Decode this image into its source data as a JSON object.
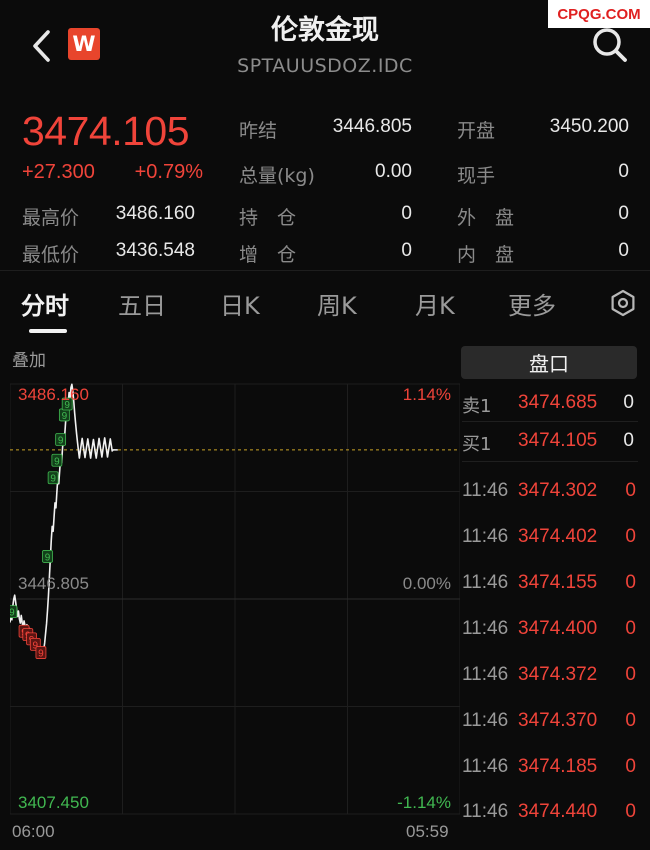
{
  "header": {
    "title": "伦敦金现",
    "subtitle": "SPTAUUSDOZ.IDC",
    "logo_letter": "W",
    "watermark": "CPQG.COM",
    "back_icon": "chevron-left-icon",
    "search_icon": "search-icon"
  },
  "quote": {
    "price": "3474.105",
    "change": "+27.300",
    "change_pct": "+0.79%",
    "fields": {
      "prev_close": {
        "label": "昨结",
        "value": "3446.805"
      },
      "open": {
        "label": "开盘",
        "value": "3450.200"
      },
      "volume": {
        "label": "总量(kg)",
        "value": "0.00"
      },
      "current_hand": {
        "label": "现手",
        "value": "0"
      },
      "high": {
        "label": "最高价",
        "value": "3486.160"
      },
      "position": {
        "label": "持　仓",
        "value": "0"
      },
      "outer": {
        "label": "外　盘",
        "value": "0"
      },
      "low": {
        "label": "最低价",
        "value": "3436.548"
      },
      "increase": {
        "label": "增　仓",
        "value": "0"
      },
      "inner": {
        "label": "内　盘",
        "value": "0"
      }
    }
  },
  "tabs": [
    {
      "label": "分时",
      "active": true
    },
    {
      "label": "五日",
      "active": false
    },
    {
      "label": "日K",
      "active": false
    },
    {
      "label": "周K",
      "active": false
    },
    {
      "label": "月K",
      "active": false
    },
    {
      "label": "更多",
      "active": false
    }
  ],
  "overlay_label": "叠加",
  "chart_data": {
    "type": "line",
    "y_labels": {
      "top": "3486.160",
      "mid": "3446.805",
      "bottom": "3407.450"
    },
    "pct_labels": {
      "top": "1.14%",
      "mid": "0.00%",
      "bottom": "-1.14%"
    },
    "x_labels": {
      "start": "06:00",
      "end": "05:59"
    },
    "ylim": [
      3407.45,
      3486.16
    ],
    "prev_close": 3446.805,
    "current": 3474.105,
    "session_minutes": 1440,
    "x": [
      0,
      3,
      6,
      9,
      12,
      15,
      18,
      21,
      24,
      27,
      30,
      33,
      36,
      39,
      42,
      45,
      48,
      51,
      54,
      57,
      60,
      63,
      66,
      69,
      72,
      75,
      78,
      81,
      84,
      87,
      90,
      93,
      96,
      99,
      102,
      105,
      108,
      111,
      114,
      117,
      120,
      123,
      126,
      129,
      132,
      135,
      138,
      141,
      144,
      147,
      150,
      153,
      156,
      159,
      162,
      165,
      168,
      171,
      174,
      177,
      180,
      183,
      186,
      189,
      192,
      195,
      198,
      201,
      204,
      207,
      210,
      213,
      216,
      219,
      222,
      225,
      228,
      231,
      234,
      237,
      240,
      243,
      246,
      249,
      252,
      255,
      258,
      261,
      264,
      267,
      270,
      273,
      276,
      279,
      282,
      285,
      288,
      291,
      294,
      297,
      300,
      303,
      306,
      309,
      312,
      315,
      318,
      321,
      324,
      327,
      330,
      333,
      336,
      339,
      342,
      345
    ],
    "values": [
      3442.5,
      3444.0,
      3443.0,
      3445.5,
      3446.8,
      3447.5,
      3446.3,
      3445.0,
      3443.6,
      3444.6,
      3443.2,
      3442.4,
      3443.8,
      3442.5,
      3441.5,
      3442.8,
      3441.9,
      3440.8,
      3442.1,
      3441.7,
      3440.1,
      3441.4,
      3440.3,
      3439.1,
      3440.4,
      3439.6,
      3438.6,
      3439.9,
      3438.5,
      3437.4,
      3438.6,
      3437.5,
      3436.7,
      3437.9,
      3437.0,
      3436.6,
      3437.5,
      3438.8,
      3440.6,
      3442.3,
      3444.7,
      3447.4,
      3450.8,
      3454.1,
      3457.5,
      3460.1,
      3459.2,
      3461.8,
      3464.4,
      3463.5,
      3466.4,
      3468.9,
      3467.9,
      3470.3,
      3472.8,
      3471.7,
      3474.3,
      3476.6,
      3475.9,
      3478.4,
      3481.0,
      3480.1,
      3482.3,
      3484.6,
      3483.4,
      3485.5,
      3486.1,
      3484.9,
      3483.0,
      3480.8,
      3478.9,
      3477.1,
      3475.5,
      3474.0,
      3472.6,
      3473.9,
      3475.1,
      3476.2,
      3475.0,
      3473.8,
      3472.7,
      3473.9,
      3475.0,
      3476.1,
      3474.9,
      3473.8,
      3472.6,
      3473.8,
      3474.9,
      3476.0,
      3474.8,
      3473.6,
      3472.6,
      3473.9,
      3475.0,
      3476.2,
      3475.0,
      3473.9,
      3472.8,
      3474.0,
      3475.2,
      3476.3,
      3475.1,
      3474.0,
      3472.8,
      3473.9,
      3475.0,
      3476.1,
      3475.0,
      3473.9,
      3474.1,
      3474.1,
      3474.1,
      3474.1,
      3474.1,
      3474.1
    ],
    "signals": [
      {
        "x": 6,
        "y": 3444.5,
        "label": "9",
        "color": "#41b851"
      },
      {
        "x": 45,
        "y": 3440.9,
        "label": "9",
        "color": "#f0443a"
      },
      {
        "x": 57,
        "y": 3440.3,
        "label": "9",
        "color": "#f0443a"
      },
      {
        "x": 69,
        "y": 3439.5,
        "label": "9",
        "color": "#f0443a"
      },
      {
        "x": 81,
        "y": 3438.5,
        "label": "9",
        "color": "#f0443a"
      },
      {
        "x": 99,
        "y": 3437.0,
        "label": "9",
        "color": "#f0443a"
      },
      {
        "x": 120,
        "y": 3454.6,
        "label": "9",
        "color": "#41b851"
      },
      {
        "x": 138,
        "y": 3469.0,
        "label": "9",
        "color": "#41b851"
      },
      {
        "x": 150,
        "y": 3472.2,
        "label": "9",
        "color": "#41b851"
      },
      {
        "x": 162,
        "y": 3476.0,
        "label": "9",
        "color": "#41b851"
      },
      {
        "x": 174,
        "y": 3480.5,
        "label": "9",
        "color": "#41b851"
      },
      {
        "x": 183,
        "y": 3482.5,
        "label": "9",
        "color": "#41b851"
      }
    ]
  },
  "order_book": {
    "button_label": "盘口",
    "ask": {
      "label": "卖1",
      "price": "3474.685",
      "vol": "0"
    },
    "bid": {
      "label": "买1",
      "price": "3474.105",
      "vol": "0"
    },
    "ticks": [
      {
        "time": "11:46",
        "price": "3474.302",
        "vol": "0"
      },
      {
        "time": "11:46",
        "price": "3474.402",
        "vol": "0"
      },
      {
        "time": "11:46",
        "price": "3474.155",
        "vol": "0"
      },
      {
        "time": "11:46",
        "price": "3474.400",
        "vol": "0"
      },
      {
        "time": "11:46",
        "price": "3474.372",
        "vol": "0"
      },
      {
        "time": "11:46",
        "price": "3474.370",
        "vol": "0"
      },
      {
        "time": "11:46",
        "price": "3474.185",
        "vol": "0"
      },
      {
        "time": "11:46",
        "price": "3474.440",
        "vol": "0"
      }
    ]
  },
  "colors": {
    "up": "#f0443a",
    "down": "#41b851",
    "background": "#0b0b0b",
    "line": "#f2f2f2",
    "prev_close_line": "#c9a227"
  }
}
